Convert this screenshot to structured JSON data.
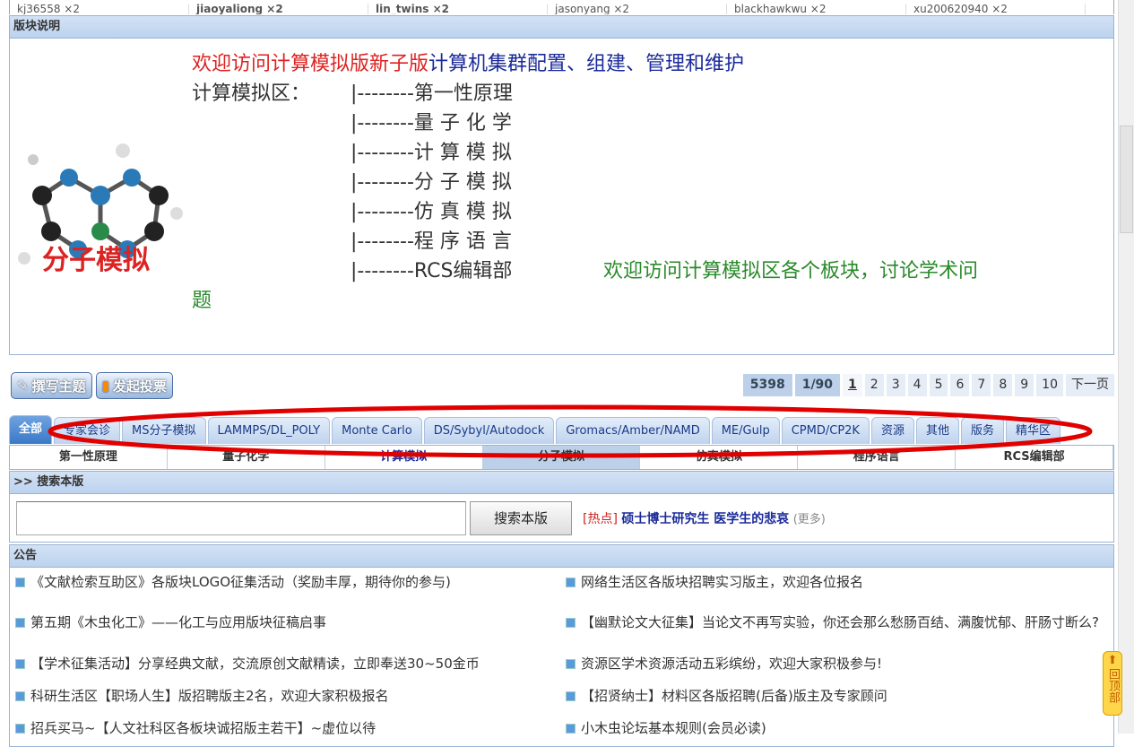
{
  "top_users": [
    "kj36558 ×2",
    "jiaoyaliong ×2",
    "lin_twins ×2",
    "jasonyang ×2",
    "blackhawkwu ×2",
    "xu200620940 ×2"
  ],
  "section_title": "版块说明",
  "description": {
    "line1_red": "欢迎访问计算模拟版新子版",
    "line1_navy": "计算机集群配置、组建、管理和维护",
    "area_label": "计算模拟区：",
    "items": [
      "|--------第一性原理",
      "|--------量 子 化 学",
      "|--------计 算 模 拟",
      "|--------分 子 模 拟",
      "|--------仿 真 模 拟",
      "|--------程 序 语 言",
      "|--------RCS编辑部"
    ],
    "welcome": "欢迎访问计算模拟区各个板块，讨论学术问",
    "welcome_tail": "题",
    "logo_text": "分子模拟"
  },
  "buttons": {
    "new_topic": "撰写主题",
    "new_poll": "发起投票"
  },
  "pager": {
    "total": "5398",
    "page": "1/90",
    "current": "1",
    "pages": [
      "2",
      "3",
      "4",
      "5",
      "6",
      "7",
      "8",
      "9",
      "10"
    ],
    "next": "下一页"
  },
  "tabs": [
    "全部",
    "专家会诊",
    "MS分子模拟",
    "LAMMPS/DL_POLY",
    "Monte Carlo",
    "DS/Sybyl/Autodock",
    "Gromacs/Amber/NAMD",
    "ME/Gulp",
    "CPMD/CP2K",
    "资源",
    "其他",
    "版务",
    "精华区"
  ],
  "subnav": [
    "第一性原理",
    "量子化学",
    "计算模拟",
    "分子模拟",
    "仿真模拟",
    "程序语言",
    "RCS编辑部"
  ],
  "search": {
    "title": ">> 搜索本版",
    "button": "搜索本版",
    "value": "",
    "hot_tag": "[热点]",
    "hot_link": "硕士博士研究生 医学生的悲哀",
    "more": "(更多)"
  },
  "announcements_title": "公告",
  "announcements": [
    "《文献检索互助区》各版块LOGO征集活动（奖励丰厚，期待你的参与)",
    "网络生活区各版块招聘实习版主，欢迎各位报名",
    "第五期《木虫化工》——化工与应用版块征稿启事",
    "【幽默论文大征集】当论文不再写实验，你还会那么愁肠百结、满腹忧郁、肝肠寸断么?",
    "【学术征集活动】分享经典文献，交流原创文献精读，立即奉送30~50金币",
    "资源区学术资源活动五彩缤纷，欢迎大家积极参与!",
    "科研生活区【职场人生】版招聘版主2名，欢迎大家积极报名",
    "【招贤纳士】材料区各版招聘(后备)版主及专家顾问",
    "招兵买马~【人文社科区各板块诚招版主若干】~虚位以待",
    "小木虫论坛基本规则(会员必读)"
  ],
  "back_to_top": "回顶部",
  "colors": {
    "accent": "#3a78c8",
    "header_bar": "#bcd2ee",
    "annotation": "#e00000"
  }
}
